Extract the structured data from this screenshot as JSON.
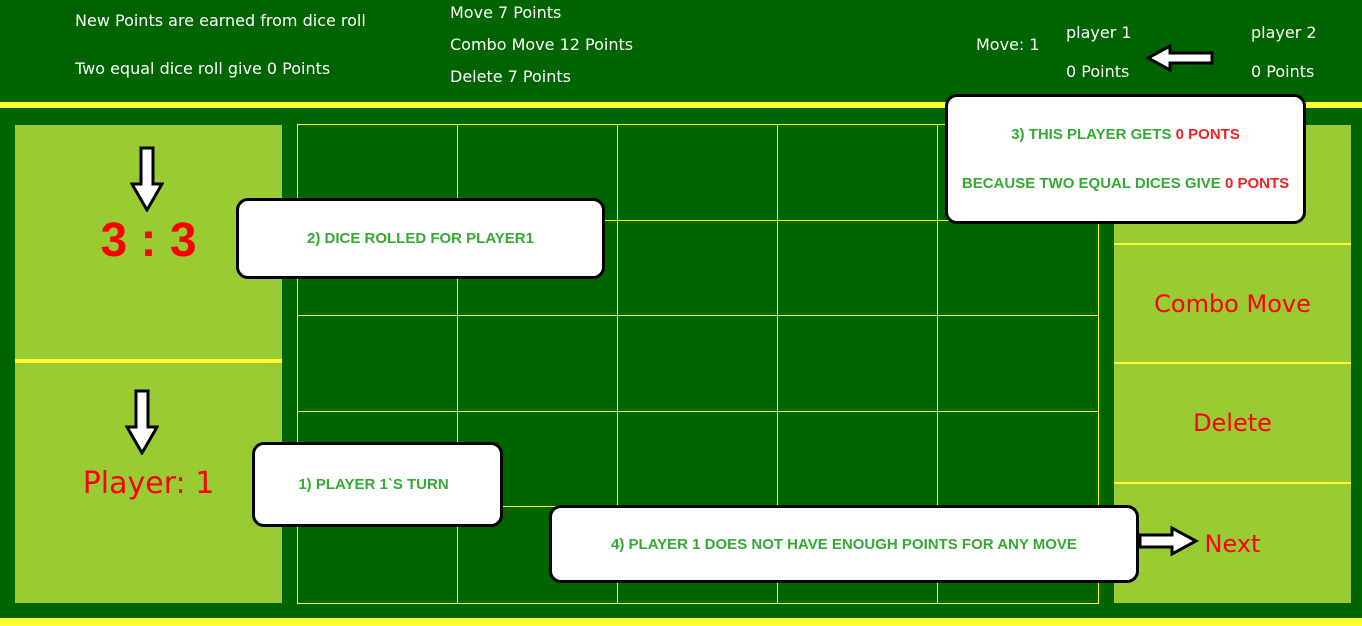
{
  "header": {
    "rule_new_points": "New Points are earned from dice roll",
    "rule_equal_dice": "Two equal dice roll give 0 Points",
    "cost_move": "Move 7 Points",
    "cost_combo": "Combo Move 12 Points",
    "cost_delete": "Delete 7 Points",
    "move_counter": "Move: 1",
    "player1_name": "player 1",
    "player1_points": "0 Points",
    "player2_name": "player 2",
    "player2_points": "0 Points"
  },
  "left_panel": {
    "dice_value": "3 : 3",
    "current_player": "Player: 1"
  },
  "side_buttons": {
    "combo_move": "Combo Move",
    "delete": "Delete",
    "next": "Next"
  },
  "callouts": {
    "c1": "1) PLAYER 1`S TURN",
    "c2": "2) DICE ROLLED FOR PLAYER1",
    "c3_line1_prefix": "3) THIS PLAYER GETS ",
    "c3_line1_highlight": "0 PONTS",
    "c3_line2_prefix": "BECAUSE TWO EQUAL DICES GIVE ",
    "c3_line2_highlight": "0 PONTS",
    "c4": "4) PLAYER 1 DOES NOT HAVE ENOUGH POINTS FOR ANY MOVE"
  },
  "board": {
    "rows": 5,
    "cols": 5
  },
  "colors": {
    "background": "#006400",
    "grid_line": "#ffff33",
    "panel": "#99cc33",
    "button_text": "#ff0000",
    "callout_text": "#33aa33",
    "callout_highlight": "#ee2222"
  }
}
